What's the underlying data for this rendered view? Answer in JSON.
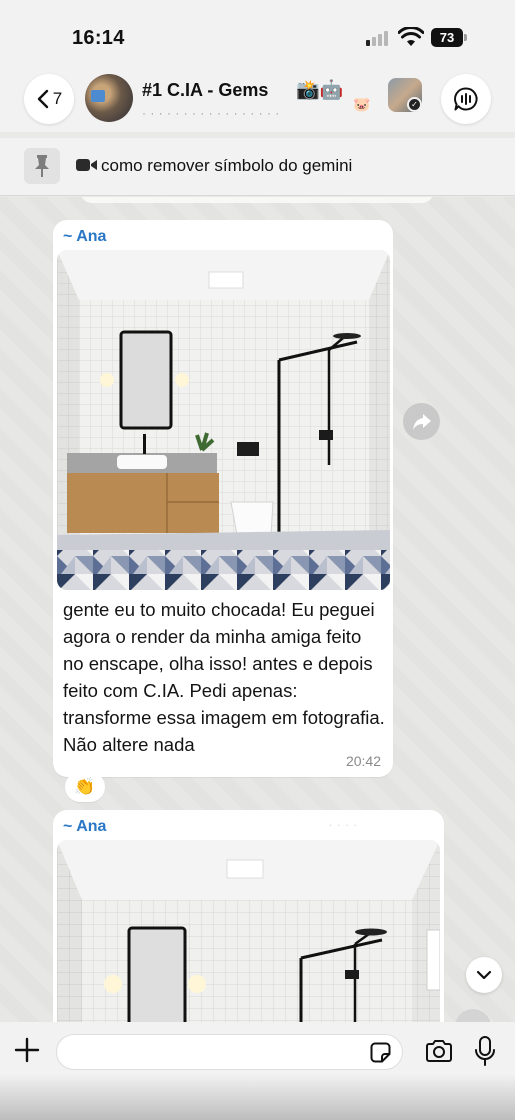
{
  "status_bar": {
    "time": "16:14",
    "battery_percent": "73",
    "signal_bars": 1,
    "icons": [
      "cellular-signal-icon",
      "wifi-icon",
      "battery-icon"
    ]
  },
  "header": {
    "back_count": "7",
    "group_title": "#1 C.IA - Gems",
    "group_emojis": "📸🤖",
    "member_emoji": "🐷",
    "icons": [
      "chevron-left-icon",
      "group-avatar",
      "contact-avatar",
      "voice-chat-icon"
    ]
  },
  "pinned": {
    "text": "como remover símbolo do gemini",
    "icons": [
      "pin-icon",
      "video-icon"
    ]
  },
  "messages": [
    {
      "sender": "~ Ana",
      "text": "gente eu to muito chocada! Eu peguei agora o render da minha amiga feito no enscape, olha isso! antes e depois feito com C.IA. Pedi apenas: transforme essa imagem em fotografia. Não altere nada",
      "time": "20:42",
      "reaction": "👏"
    },
    {
      "sender": "~ Ana"
    }
  ],
  "composer": {
    "input_value": "",
    "icons": [
      "plus-icon",
      "sticker-icon",
      "camera-icon",
      "microphone-icon"
    ]
  },
  "colors": {
    "sender_name": "#2a78c5",
    "bubble": "#ffffff",
    "chat_background": "#e7e7e5",
    "bar_background": "#f2f2f2"
  }
}
